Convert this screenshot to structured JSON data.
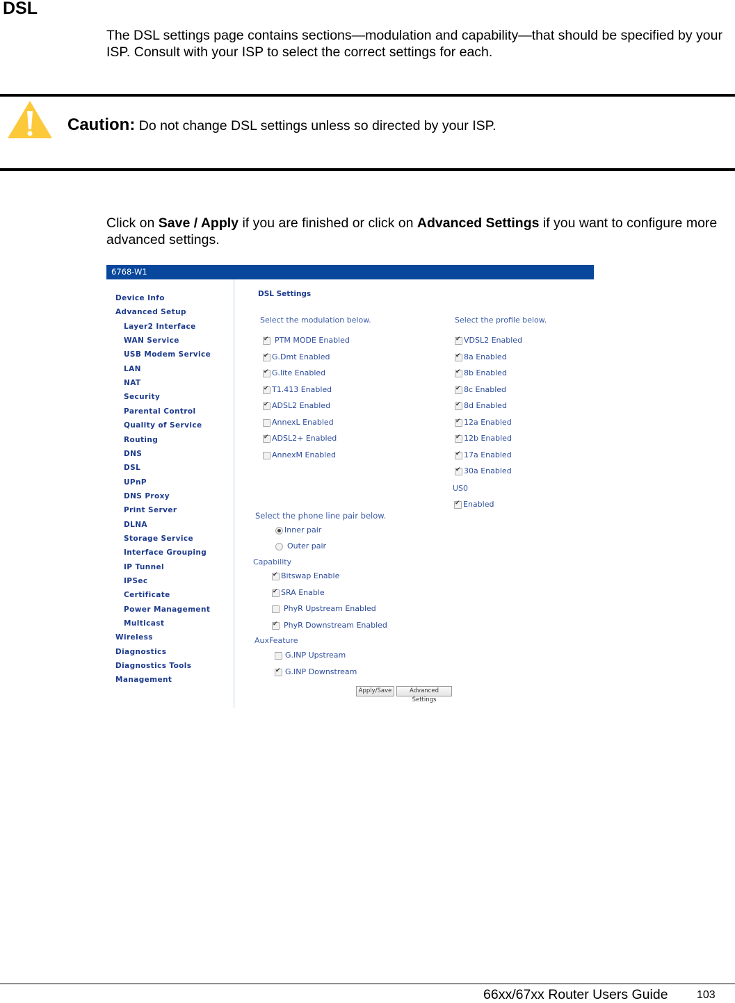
{
  "document": {
    "title": "DSL",
    "intro": "The DSL settings page contains sections—modulation and capability—that should be specified by your ISP. Consult with your ISP to select the correct settings for each.",
    "caution": {
      "icon": "warning-triangle-icon",
      "label": "Caution:",
      "text": "Do not change DSL settings unless so directed by your ISP."
    },
    "instruction": {
      "part1": "Click on ",
      "bold1": "Save / Apply",
      "part2": " if you are finished or click on ",
      "bold2": "Advanced Settings",
      "part3": " if you want to configure more advanced settings."
    },
    "footer": {
      "guide_title": "66xx/67xx Router Users Guide",
      "page_number": "103"
    }
  },
  "router_ui": {
    "header_title": "6768-W1",
    "brand_color": "#08479c",
    "nav": [
      {
        "label": "Device Info",
        "level": "top"
      },
      {
        "label": "Advanced Setup",
        "level": "top"
      },
      {
        "label": "Layer2 Interface",
        "level": "sub"
      },
      {
        "label": "WAN Service",
        "level": "sub"
      },
      {
        "label": "USB Modem Service",
        "level": "sub"
      },
      {
        "label": "LAN",
        "level": "sub"
      },
      {
        "label": "NAT",
        "level": "sub"
      },
      {
        "label": "Security",
        "level": "sub"
      },
      {
        "label": "Parental Control",
        "level": "sub"
      },
      {
        "label": "Quality of Service",
        "level": "sub"
      },
      {
        "label": "Routing",
        "level": "sub"
      },
      {
        "label": "DNS",
        "level": "sub"
      },
      {
        "label": "DSL",
        "level": "sub"
      },
      {
        "label": "UPnP",
        "level": "sub"
      },
      {
        "label": "DNS Proxy",
        "level": "sub"
      },
      {
        "label": "Print Server",
        "level": "sub"
      },
      {
        "label": "DLNA",
        "level": "sub"
      },
      {
        "label": "Storage Service",
        "level": "sub"
      },
      {
        "label": "Interface Grouping",
        "level": "sub"
      },
      {
        "label": "IP Tunnel",
        "level": "sub"
      },
      {
        "label": "IPSec",
        "level": "sub"
      },
      {
        "label": "Certificate",
        "level": "sub"
      },
      {
        "label": "Power Management",
        "level": "sub"
      },
      {
        "label": "Multicast",
        "level": "sub"
      },
      {
        "label": "Wireless",
        "level": "top"
      },
      {
        "label": "Diagnostics",
        "level": "top"
      },
      {
        "label": "Diagnostics Tools",
        "level": "top"
      },
      {
        "label": "Management",
        "level": "top"
      }
    ],
    "page_heading": "DSL Settings",
    "modulation": {
      "prompt": "Select the modulation below.",
      "options": [
        {
          "label": "PTM MODE Enabled",
          "checked": true
        },
        {
          "label": "G.Dmt Enabled",
          "checked": true
        },
        {
          "label": "G.lite Enabled",
          "checked": true
        },
        {
          "label": "T1.413 Enabled",
          "checked": true
        },
        {
          "label": "ADSL2 Enabled",
          "checked": true
        },
        {
          "label": "AnnexL Enabled",
          "checked": false
        },
        {
          "label": "ADSL2+ Enabled",
          "checked": true
        },
        {
          "label": "AnnexM Enabled",
          "checked": false
        }
      ]
    },
    "profile": {
      "prompt": "Select the profile below.",
      "options": [
        {
          "label": "VDSL2 Enabled",
          "checked": true
        },
        {
          "label": "8a Enabled",
          "checked": true
        },
        {
          "label": "8b Enabled",
          "checked": true
        },
        {
          "label": "8c Enabled",
          "checked": true
        },
        {
          "label": "8d Enabled",
          "checked": true
        },
        {
          "label": "12a Enabled",
          "checked": true
        },
        {
          "label": "12b Enabled",
          "checked": true
        },
        {
          "label": "17a Enabled",
          "checked": true
        },
        {
          "label": "30a Enabled",
          "checked": true
        }
      ],
      "us0_label": "US0",
      "us0_option": {
        "label": "Enabled",
        "checked": true
      }
    },
    "phone_line": {
      "prompt": "Select the phone line pair below.",
      "options": [
        {
          "label": "Inner pair",
          "selected": true
        },
        {
          "label": "Outer pair",
          "selected": false
        }
      ]
    },
    "capability": {
      "label": "Capability",
      "options": [
        {
          "label": "Bitswap Enable",
          "checked": true
        },
        {
          "label": "SRA Enable",
          "checked": true
        },
        {
          "label": "PhyR Upstream Enabled",
          "checked": false
        },
        {
          "label": "PhyR Downstream Enabled",
          "checked": true
        }
      ]
    },
    "aux_feature": {
      "label": "AuxFeature",
      "options": [
        {
          "label": "G.INP Upstream",
          "checked": false
        },
        {
          "label": "G.INP Downstream",
          "checked": true
        }
      ]
    },
    "buttons": {
      "apply_save": "Apply/Save",
      "advanced_settings": "Advanced Settings"
    }
  }
}
